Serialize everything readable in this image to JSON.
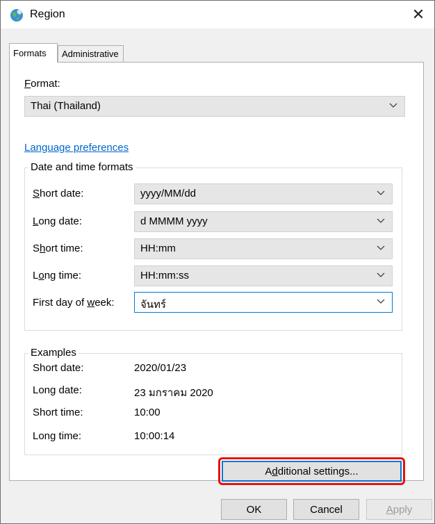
{
  "window": {
    "title": "Region",
    "close_glyph": "✕",
    "icon": "globe-icon"
  },
  "tabs": [
    {
      "label": "Formats",
      "active": true
    },
    {
      "label": "Administrative",
      "active": false
    }
  ],
  "format": {
    "label": "Format:",
    "value": "Thai (Thailand)"
  },
  "language_preferences_link": "Language preferences",
  "date_time_formats": {
    "title": "Date and time formats",
    "rows": [
      {
        "label": "Short date:",
        "value": "yyyy/MM/dd"
      },
      {
        "label": "Long date:",
        "value": "d MMMM yyyy"
      },
      {
        "label": "Short time:",
        "value": "HH:mm"
      },
      {
        "label": "Long time:",
        "value": "HH:mm:ss"
      },
      {
        "label": "First day of week:",
        "value": "จันทร์"
      }
    ]
  },
  "examples": {
    "title": "Examples",
    "rows": [
      {
        "label": "Short date:",
        "value": "2020/01/23"
      },
      {
        "label": "Long date:",
        "value": "23 มกราคม 2020"
      },
      {
        "label": "Short time:",
        "value": "10:00"
      },
      {
        "label": "Long time:",
        "value": "10:00:14"
      }
    ]
  },
  "buttons": {
    "additional_settings": "Additional settings...",
    "ok": "OK",
    "cancel": "Cancel",
    "apply": "Apply"
  },
  "colors": {
    "link": "#0066cc",
    "focus": "#0078d7",
    "highlight": "#e8120c"
  }
}
